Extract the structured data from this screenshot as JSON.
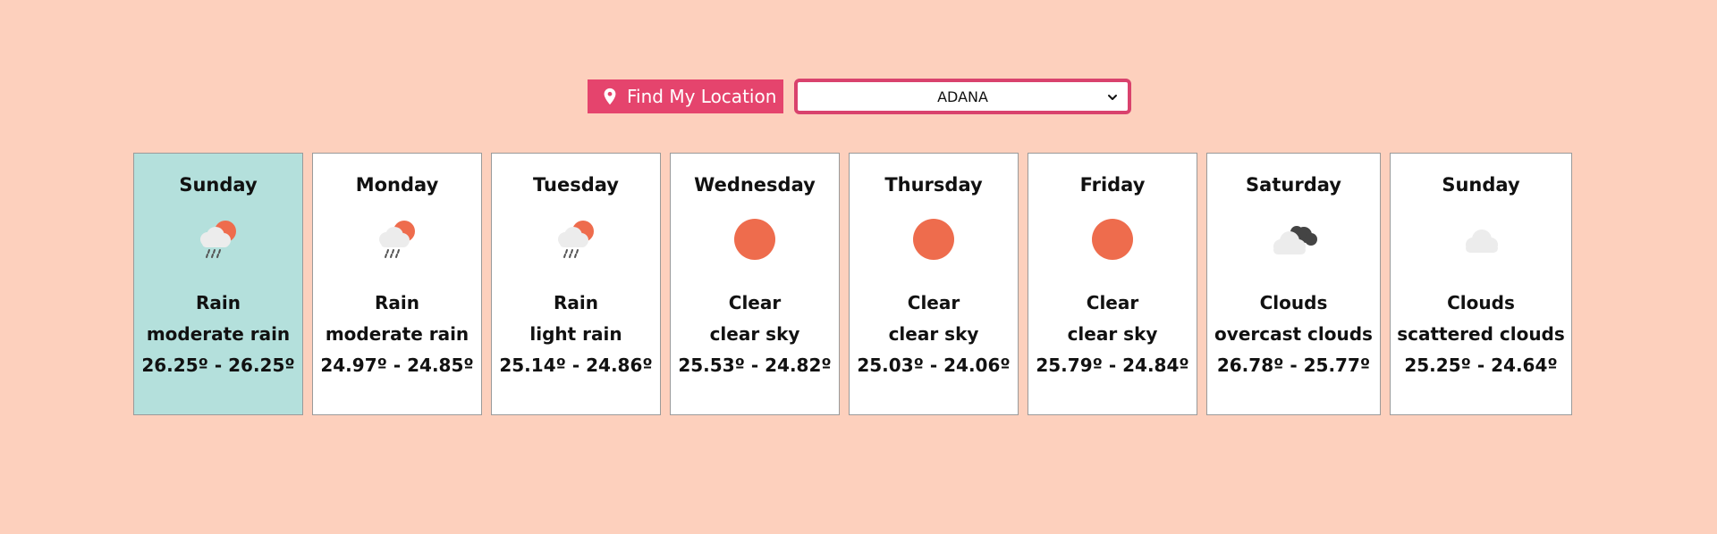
{
  "location_button": {
    "label": "Find My Location",
    "icon": "map-pin-icon",
    "bg_color": "#e5446d"
  },
  "city_select": {
    "value": "ADANA",
    "icon": "chevron-down-icon",
    "border_color": "#d9426d"
  },
  "colors": {
    "page_bg": "#fdd0bd",
    "active_card": "#b4e0dc",
    "sun": "#ee6c4d",
    "cloud": "#ececec",
    "dark_cloud": "#444444"
  },
  "forecast": [
    {
      "day": "Sunday",
      "main": "Rain",
      "description": "moderate rain",
      "temp": "26.25º - 26.25º",
      "icon": "rain-sun-icon",
      "active": true
    },
    {
      "day": "Monday",
      "main": "Rain",
      "description": "moderate rain",
      "temp": "24.97º - 24.85º",
      "icon": "rain-sun-icon",
      "active": false
    },
    {
      "day": "Tuesday",
      "main": "Rain",
      "description": "light rain",
      "temp": "25.14º - 24.86º",
      "icon": "rain-sun-icon",
      "active": false
    },
    {
      "day": "Wednesday",
      "main": "Clear",
      "description": "clear sky",
      "temp": "25.53º - 24.82º",
      "icon": "sun-icon",
      "active": false
    },
    {
      "day": "Thursday",
      "main": "Clear",
      "description": "clear sky",
      "temp": "25.03º - 24.06º",
      "icon": "sun-icon",
      "active": false
    },
    {
      "day": "Friday",
      "main": "Clear",
      "description": "clear sky",
      "temp": "25.79º - 24.84º",
      "icon": "sun-icon",
      "active": false
    },
    {
      "day": "Saturday",
      "main": "Clouds",
      "description": "overcast clouds",
      "temp": "26.78º - 25.77º",
      "icon": "overcast-clouds-icon",
      "active": false
    },
    {
      "day": "Sunday",
      "main": "Clouds",
      "description": "scattered clouds",
      "temp": "25.25º - 24.64º",
      "icon": "cloud-icon",
      "active": false
    }
  ]
}
